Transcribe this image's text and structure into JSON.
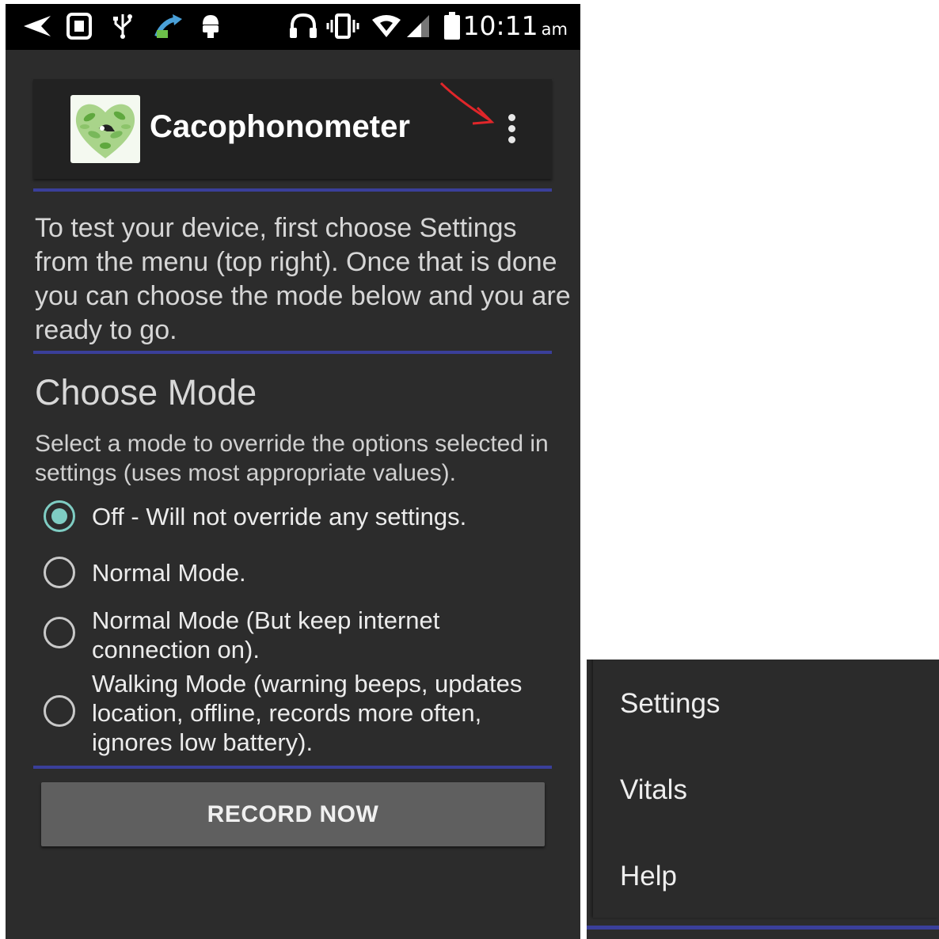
{
  "status_bar": {
    "time": "10:11",
    "ampm": "am",
    "icons": [
      "back-arrow-icon",
      "sim-icon",
      "usb-icon",
      "upload-icon",
      "android-icon",
      "headphones-icon",
      "vibrate-icon",
      "wifi-icon",
      "signal-icon",
      "battery-icon"
    ]
  },
  "app_bar": {
    "title": "Cacophonometer",
    "logo_icon": "heart-leaves-bird-logo",
    "overflow_icon": "overflow-menu-icon"
  },
  "intro_text": "To test your device, first choose Settings from the menu (top right). Once that is done you can choose the mode below and you are ready to go.",
  "choose_mode": {
    "title": "Choose Mode",
    "description": "Select a mode to override the options selected in settings (uses most appropriate values).",
    "options": [
      {
        "label": "Off - Will not override any settings.",
        "checked": true
      },
      {
        "label": "Normal Mode.",
        "checked": false
      },
      {
        "label": "Normal Mode (But keep internet connection on).",
        "checked": false
      },
      {
        "label": "Walking Mode (warning beeps, updates location, offline, records more often, ignores low battery).",
        "checked": false
      }
    ]
  },
  "record_button": "RECORD NOW",
  "overflow_menu": {
    "items": [
      "Settings",
      "Vitals",
      "Help"
    ]
  },
  "colors": {
    "background": "#2c2c2c",
    "divider": "#3a3f9a",
    "radio_checked": "#7fcdc3",
    "annotation_arrow": "#e0262a"
  }
}
